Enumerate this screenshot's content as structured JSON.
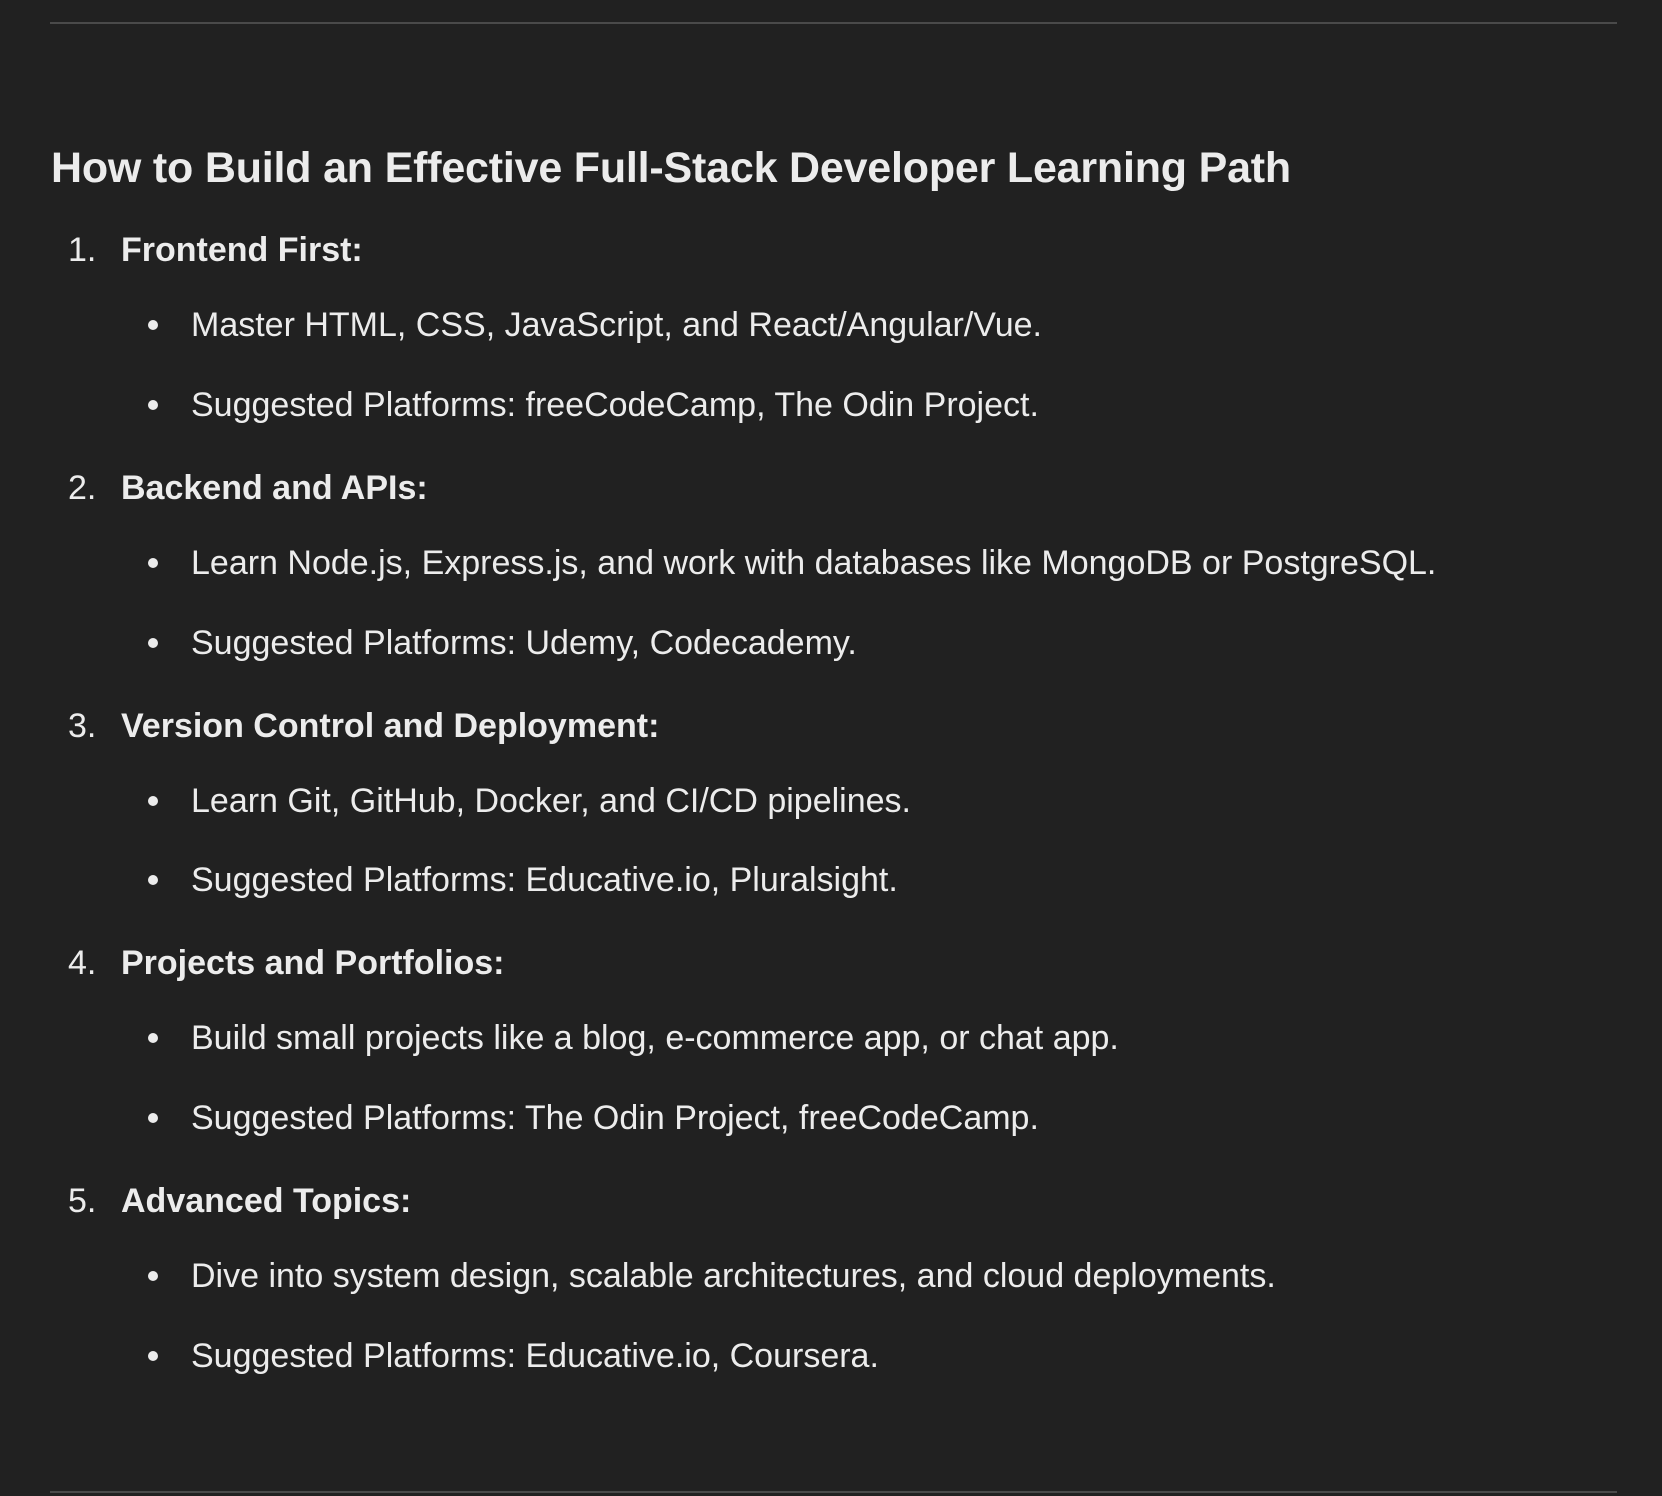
{
  "heading": "How to Build an Effective Full-Stack Developer Learning Path",
  "sections": [
    {
      "number": "1.",
      "title": "Frontend First:",
      "bullets": [
        "Master HTML, CSS, JavaScript, and React/Angular/Vue.",
        "Suggested Platforms: freeCodeCamp, The Odin Project."
      ]
    },
    {
      "number": "2.",
      "title": "Backend and APIs:",
      "bullets": [
        "Learn Node.js, Express.js, and work with databases like MongoDB or PostgreSQL.",
        "Suggested Platforms: Udemy, Codecademy."
      ]
    },
    {
      "number": "3.",
      "title": "Version Control and Deployment:",
      "bullets": [
        "Learn Git, GitHub, Docker, and CI/CD pipelines.",
        "Suggested Platforms: Educative.io, Pluralsight."
      ]
    },
    {
      "number": "4.",
      "title": "Projects and Portfolios:",
      "bullets": [
        "Build small projects like a blog, e-commerce app, or chat app.",
        "Suggested Platforms: The Odin Project, freeCodeCamp."
      ]
    },
    {
      "number": "5.",
      "title": "Advanced Topics:",
      "bullets": [
        "Dive into system design, scalable architectures, and cloud deployments.",
        "Suggested Platforms: Educative.io, Coursera."
      ]
    }
  ],
  "colors": {
    "background": "#212121",
    "text": "#ececec",
    "divider": "#4a4a4a"
  }
}
